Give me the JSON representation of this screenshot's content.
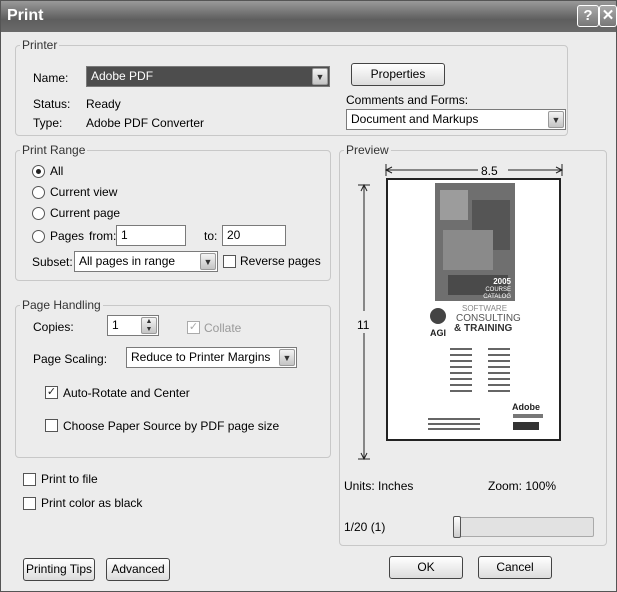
{
  "window": {
    "title": "Print"
  },
  "printer": {
    "legend": "Printer",
    "name_label": "Name:",
    "name_value": "Adobe PDF",
    "status_label": "Status:",
    "status_value": "Ready",
    "type_label": "Type:",
    "type_value": "Adobe PDF Converter",
    "properties_label": "Properties",
    "comments_label": "Comments and Forms:",
    "comments_value": "Document and Markups"
  },
  "print_range": {
    "legend": "Print Range",
    "all_label": "All",
    "current_view_label": "Current view",
    "current_page_label": "Current page",
    "pages_label": "Pages",
    "from_label": "from:",
    "from_value": "1",
    "to_label": "to:",
    "to_value": "20",
    "subset_label": "Subset:",
    "subset_value": "All pages in range",
    "reverse_label": "Reverse pages",
    "selected": "all"
  },
  "page_handling": {
    "legend": "Page Handling",
    "copies_label": "Copies:",
    "copies_value": "1",
    "collate_label": "Collate",
    "scaling_label": "Page Scaling:",
    "scaling_value": "Reduce to Printer Margins",
    "autorotate_label": "Auto-Rotate and Center",
    "autorotate_checked": true,
    "paper_source_label": "Choose Paper Source by PDF page size",
    "paper_source_checked": false
  },
  "options": {
    "print_to_file_label": "Print to file",
    "print_color_black_label": "Print color as black"
  },
  "preview": {
    "legend": "Preview",
    "width_value": "8.5",
    "height_value": "11",
    "units_text": "Units: Inches",
    "zoom_text": "Zoom: 100%",
    "page_indicator": "1/20 (1)",
    "slider_position": 0.0,
    "thumbnail": {
      "year": "2005",
      "catalog_line1": "COURSE",
      "catalog_line2": "CATALOG",
      "brand_line1": "SOFTWARE",
      "brand_line2": "CONSULTING",
      "brand_line3": "& TRAINING",
      "logo_text": "AGI",
      "adobe_text": "Adobe"
    }
  },
  "footer": {
    "tips_label": "Printing Tips",
    "advanced_label": "Advanced",
    "ok_label": "OK",
    "cancel_label": "Cancel"
  }
}
